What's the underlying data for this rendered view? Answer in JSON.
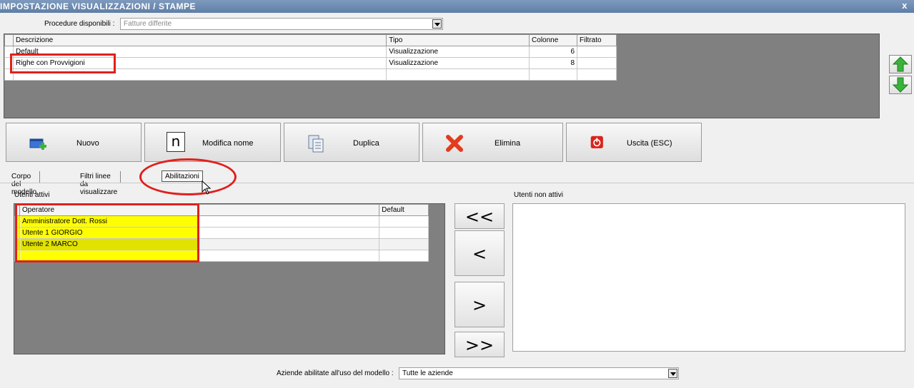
{
  "window": {
    "title": "IMPOSTAZIONE VISUALIZZAZIONI / STAMPE",
    "close_glyph": "x"
  },
  "procedure": {
    "label": "Procedure disponibili :",
    "value": "Fatture differite"
  },
  "models_table": {
    "headers": [
      "Descrizione",
      "Tipo",
      "Colonne",
      "Filtrato"
    ],
    "rows": [
      {
        "descrizione": "Default",
        "tipo": "Visualizzazione",
        "colonne": "6",
        "filtrato": ""
      },
      {
        "descrizione": "Righe con Provvigioni",
        "tipo": "Visualizzazione",
        "colonne": "8",
        "filtrato": ""
      }
    ]
  },
  "toolbar": {
    "nuovo": "Nuovo",
    "modifica_nome": "Modifica nome",
    "modifica_icon_letter": "n",
    "duplica": "Duplica",
    "elimina": "Elimina",
    "uscita": "Uscita (ESC)"
  },
  "tabs": [
    "Corpo del modello",
    "Filtri linee da visualizzare",
    "Abilitazioni"
  ],
  "active_users": {
    "label": "Utenti attivi",
    "headers": [
      "Operatore",
      "Default"
    ],
    "rows": [
      "Amministratore Dott. Rossi",
      "Utente 1 GIORGIO",
      "Utente 2 MARCO"
    ]
  },
  "inactive_users": {
    "label": "Utenti non attivi"
  },
  "movers": {
    "all_left": "<<",
    "left": "<",
    "right": ">",
    "all_right": ">>"
  },
  "aziende": {
    "label": "Aziende abilitate all'uso del modello :",
    "value": "Tutte le aziende"
  },
  "colors": {
    "highlight_red": "#e0201c",
    "selection_yellow": "#ffff00",
    "grid_bg": "#808080",
    "arrow_green": "#3bb33b"
  }
}
